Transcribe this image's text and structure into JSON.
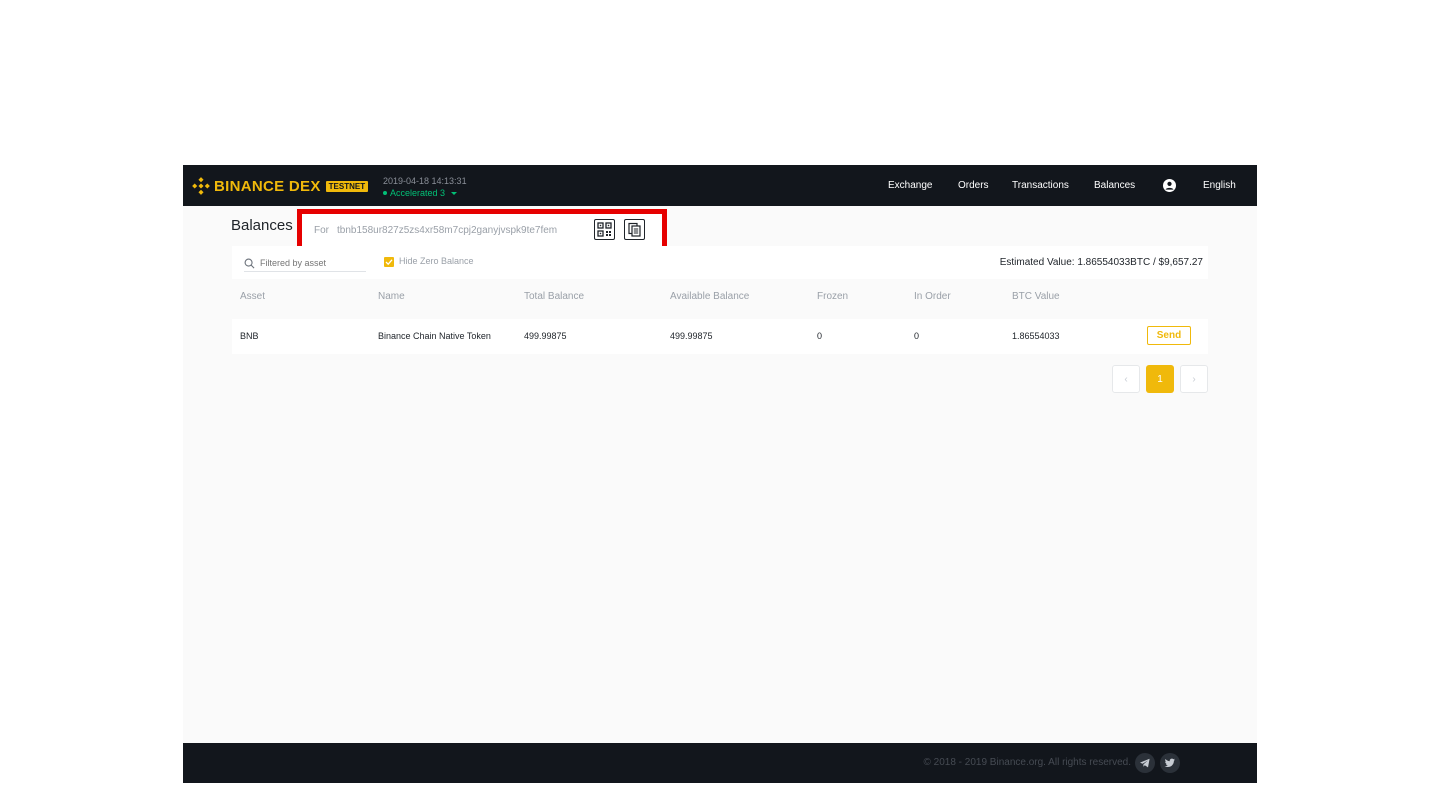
{
  "header": {
    "brand": "BINANCE DEX",
    "badge": "TESTNET",
    "timestamp": "2019-04-18 14:13:31",
    "node": "Accelerated 3",
    "nav": {
      "exchange": "Exchange",
      "orders": "Orders",
      "transactions": "Transactions",
      "balances": "Balances",
      "language": "English"
    },
    "accent_color": "#f0b90b",
    "status_color": "#02c076"
  },
  "page": {
    "title": "Balances",
    "address_prefix": "For",
    "address": "tbnb158ur827z5zs4xr58m7cpj2ganyjvspk9te7fem",
    "qr_icon": "qr-code-icon",
    "copy_icon": "copy-icon",
    "highlight_color": "#e60000"
  },
  "filters": {
    "search_placeholder": "Filtered by asset",
    "hide_zero_label": "Hide Zero Balance",
    "hide_zero_checked": true,
    "estimated_value": "Estimated Value: 1.86554033BTC / $9,657.27"
  },
  "table": {
    "columns": {
      "asset": "Asset",
      "name": "Name",
      "total": "Total Balance",
      "available": "Available Balance",
      "frozen": "Frozen",
      "in_order": "In Order",
      "btc": "BTC Value"
    },
    "rows": [
      {
        "asset": "BNB",
        "name": "Binance Chain Native Token",
        "total": "499.99875",
        "available": "499.99875",
        "frozen": "0",
        "in_order": "0",
        "btc": "1.86554033",
        "action": "Send"
      }
    ]
  },
  "pagination": {
    "prev": "‹",
    "current": "1",
    "next": "›"
  },
  "footer": {
    "copyright": "© 2018 - 2019 Binance.org. All rights reserved.",
    "social_icons": [
      "telegram-icon",
      "twitter-icon"
    ]
  }
}
